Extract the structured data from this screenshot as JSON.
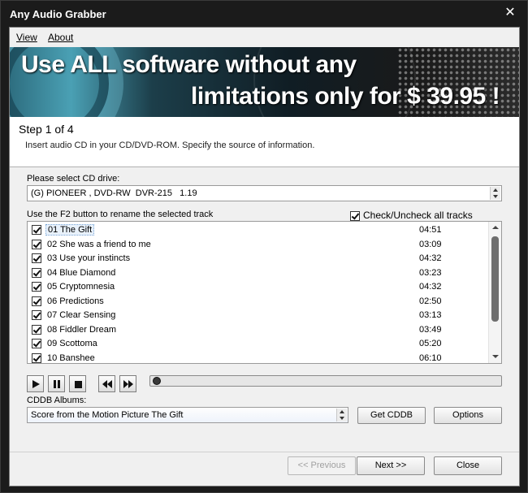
{
  "window": {
    "title": "Any Audio Grabber"
  },
  "menu": [
    {
      "label": "View"
    },
    {
      "label": "About"
    }
  ],
  "banner": {
    "line1": "Use ALL software without any",
    "line2": "limitations only for $ 39.95 !"
  },
  "step": {
    "title": "Step 1 of 4",
    "description": "Insert audio CD in your CD/DVD-ROM. Specify the source of information."
  },
  "drive": {
    "label": "Please select CD drive:",
    "selected": "(G) PIONEER , DVD-RW  DVR-215   1.19"
  },
  "tracks": {
    "hint": "Use the F2 button to rename the selected track",
    "check_all_label": "Check/Uncheck all tracks",
    "items": [
      {
        "name": "01 The Gift",
        "time": "04:51"
      },
      {
        "name": "02 She was a friend to me",
        "time": "03:09"
      },
      {
        "name": "03 Use your instincts",
        "time": "04:32"
      },
      {
        "name": "04 Blue Diamond",
        "time": "03:23"
      },
      {
        "name": "05 Cryptomnesia",
        "time": "04:32"
      },
      {
        "name": "06 Predictions",
        "time": "02:50"
      },
      {
        "name": "07 Clear Sensing",
        "time": "03:13"
      },
      {
        "name": "08 Fiddler Dream",
        "time": "03:49"
      },
      {
        "name": "09 Scottoma",
        "time": "05:20"
      },
      {
        "name": "10 Banshee",
        "time": "06:10"
      }
    ]
  },
  "cddb": {
    "label": "CDDB Albums:",
    "selected": "Score from the Motion Picture The Gift",
    "get_button": "Get CDDB",
    "options_button": "Options"
  },
  "footer": {
    "previous": "<< Previous",
    "next": "Next >>",
    "close": "Close"
  },
  "colors": {
    "titlebar": "#1b1b1b",
    "selection": "#e8f1fb"
  }
}
